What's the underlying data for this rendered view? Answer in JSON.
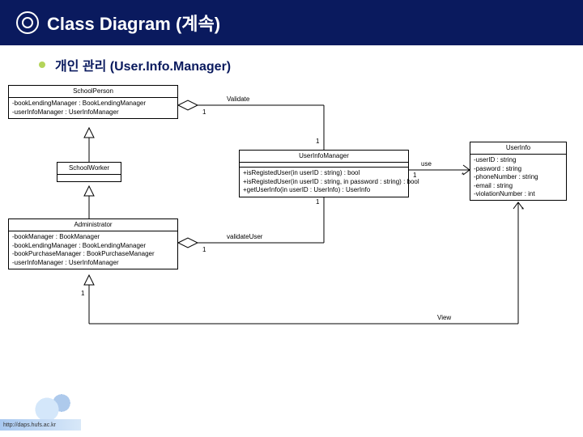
{
  "header": {
    "title": "Class Diagram (계속)"
  },
  "subtitle": "개인 관리 (User.Info.Manager)",
  "classes": {
    "schoolPerson": {
      "name": "SchoolPerson",
      "attrs": [
        "-bookLendingManager : BookLendingManager",
        "-userInfoManager : UserInfoManager"
      ]
    },
    "schoolWorker": {
      "name": "SchoolWorker",
      "attrs": []
    },
    "administrator": {
      "name": "Administrator",
      "attrs": [
        "-bookManager : BookManager",
        "-bookLendingManager : BookLendingManager",
        "-bookPurchaseManager : BookPurchaseManager",
        "-userInfoManager : UserInfoManager"
      ]
    },
    "userInfoManager": {
      "name": "UserInfoManager",
      "ops": [
        "+isRegistedUser(in userID : string) : bool",
        "+isRegistedUser(in userID : string, in password : string) : bool",
        "+getUserInfo(in userID : UserInfo) : UserInfo"
      ]
    },
    "userInfo": {
      "name": "UserInfo",
      "attrs": [
        "-userID : string",
        "-pasword : string",
        "-phoneNumber : string",
        "-email : string",
        "-violationNumber : int"
      ]
    }
  },
  "labels": {
    "validate": "Validate",
    "validateUser": "validateUser",
    "use": "use",
    "view": "View",
    "one": "1",
    "star": "*"
  },
  "footer": {
    "url": "http://daps.hufs.ac.kr"
  }
}
